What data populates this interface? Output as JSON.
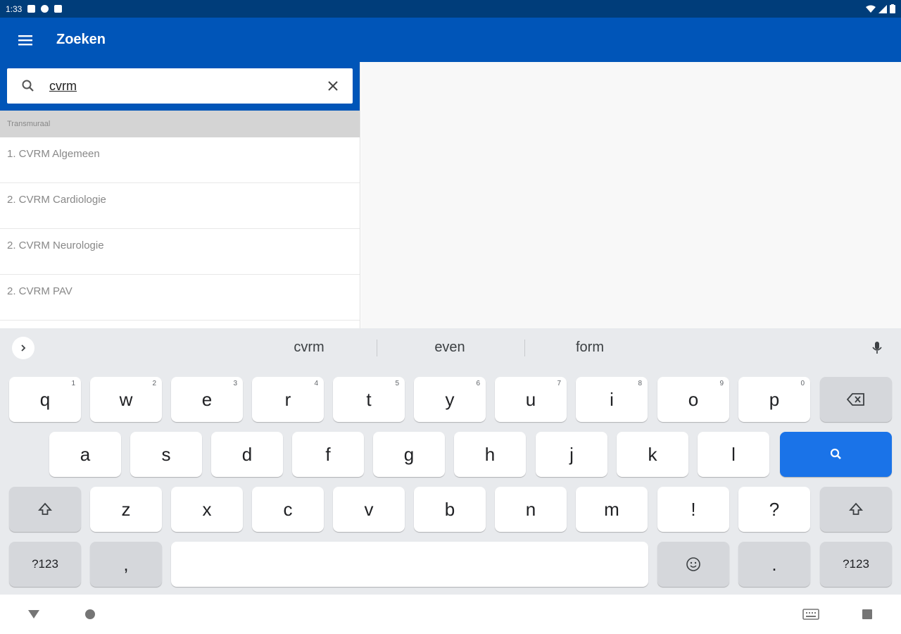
{
  "status_bar": {
    "time": "1:33"
  },
  "app_bar": {
    "title": "Zoeken"
  },
  "search": {
    "value": "cvrm"
  },
  "results": {
    "section_label": "Transmuraal",
    "items": [
      {
        "label": "1. CVRM Algemeen"
      },
      {
        "label": "2. CVRM Cardiologie"
      },
      {
        "label": "2. CVRM Neurologie"
      },
      {
        "label": "2. CVRM PAV"
      }
    ]
  },
  "keyboard": {
    "suggestions": [
      "cvrm",
      "even",
      "form"
    ],
    "row1": [
      {
        "k": "q",
        "hint": "1"
      },
      {
        "k": "w",
        "hint": "2"
      },
      {
        "k": "e",
        "hint": "3"
      },
      {
        "k": "r",
        "hint": "4"
      },
      {
        "k": "t",
        "hint": "5"
      },
      {
        "k": "y",
        "hint": "6"
      },
      {
        "k": "u",
        "hint": "7"
      },
      {
        "k": "i",
        "hint": "8"
      },
      {
        "k": "o",
        "hint": "9"
      },
      {
        "k": "p",
        "hint": "0"
      }
    ],
    "row2": [
      "a",
      "s",
      "d",
      "f",
      "g",
      "h",
      "j",
      "k",
      "l"
    ],
    "row3": [
      "z",
      "x",
      "c",
      "v",
      "b",
      "n",
      "m",
      "!",
      "?"
    ],
    "symbols_label": "?123",
    "comma": ",",
    "period": ".",
    "accent_color": "#1a73e8"
  },
  "colors": {
    "primary": "#0055b8",
    "status_bar": "#003d7a"
  }
}
